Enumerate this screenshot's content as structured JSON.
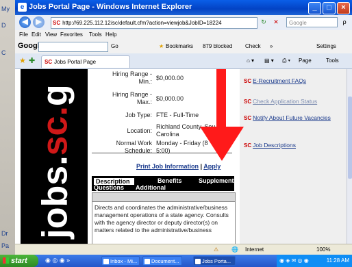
{
  "window": {
    "title": "Jobs Portal Page - Windows Internet Explorer",
    "min": "_",
    "max": "□",
    "close": "×"
  },
  "desktop_left": {
    "icons": [
      "My",
      "D",
      "C",
      "Dr",
      "Pa"
    ]
  },
  "address_bar": {
    "back": "◀",
    "forward": "▶",
    "prefix": "SC",
    "url": "http://69.225.112.12/sc/default.cfm?action=viewjob&JobID=18224",
    "refresh": "↻",
    "stop": "✕",
    "search_placeholder": "Google",
    "search_btn": "ρ"
  },
  "menu": {
    "items": [
      "File",
      "Edit",
      "View",
      "Favorites",
      "Tools",
      "Help"
    ]
  },
  "google_toolbar": {
    "logo": "Google",
    "go": "Go",
    "bookmarks": "Bookmarks",
    "blocked": "879 blocked",
    "check": "Check",
    "more": "»",
    "settings": "Settings"
  },
  "tab_row": {
    "tab_prefix": "SC",
    "tab_label": "Jobs Portal Page",
    "page": "Page",
    "tools": "Tools"
  },
  "job": {
    "fields": [
      {
        "label": "Hiring Range -",
        "label2": "Min.:",
        "value": "$0,000.00",
        "value2": ""
      },
      {
        "label": "Hiring Range -",
        "label2": "Max.:",
        "value": "$0,000.00",
        "value2": ""
      },
      {
        "label": "Job Type:",
        "label2": "",
        "value": "FTE - Full-Time",
        "value2": ""
      },
      {
        "label": "Location:",
        "label2": "",
        "value": "Richland County, Sou",
        "value2": "Carolina"
      },
      {
        "label": "Normal Work",
        "label2": "Schedule:",
        "value": "Monday - Friday (8",
        "value2": "5:00)"
      }
    ],
    "print_label": "Print Job Information",
    "separator": "|",
    "apply_label": "Apply",
    "tabs": {
      "description": "Description",
      "benefits": "Benefits",
      "supplemental": "Supplemental",
      "questions": "Questions",
      "additional": "Additional"
    },
    "description_text": "Directs and coordinates the administrative/business management operations of a state agency. Consults with the agency director or deputy director(s) on matters related to the administrative/business"
  },
  "logo_text": {
    "part1": "jobs.",
    "part2": "sc.",
    "part3": "g"
  },
  "right_links": [
    {
      "prefix": "SC",
      "label": "E-Recruitment FAQs",
      "dim": false
    },
    {
      "prefix": "SC",
      "label": "Check Application Status",
      "dim": true
    },
    {
      "prefix": "SC",
      "label": "Notify About Future Vacancies",
      "dim": false
    },
    {
      "prefix": "SC",
      "label": "Job Descriptions",
      "dim": false
    }
  ],
  "status_bar": {
    "zone": "Internet",
    "zoom": "100%"
  },
  "taskbar": {
    "start": "start",
    "items": [
      {
        "label": "Inbox - Mi...",
        "active": false
      },
      {
        "label": "Document...",
        "active": false
      },
      {
        "label": "Jobs Porta...",
        "active": true
      }
    ],
    "clock": "11:28 AM"
  },
  "colors": {
    "title_blue": "#0343c4",
    "annotation_arrow": "#ff1a1a",
    "link_blue": "#1a3a8c",
    "logo_red": "#d01818"
  }
}
